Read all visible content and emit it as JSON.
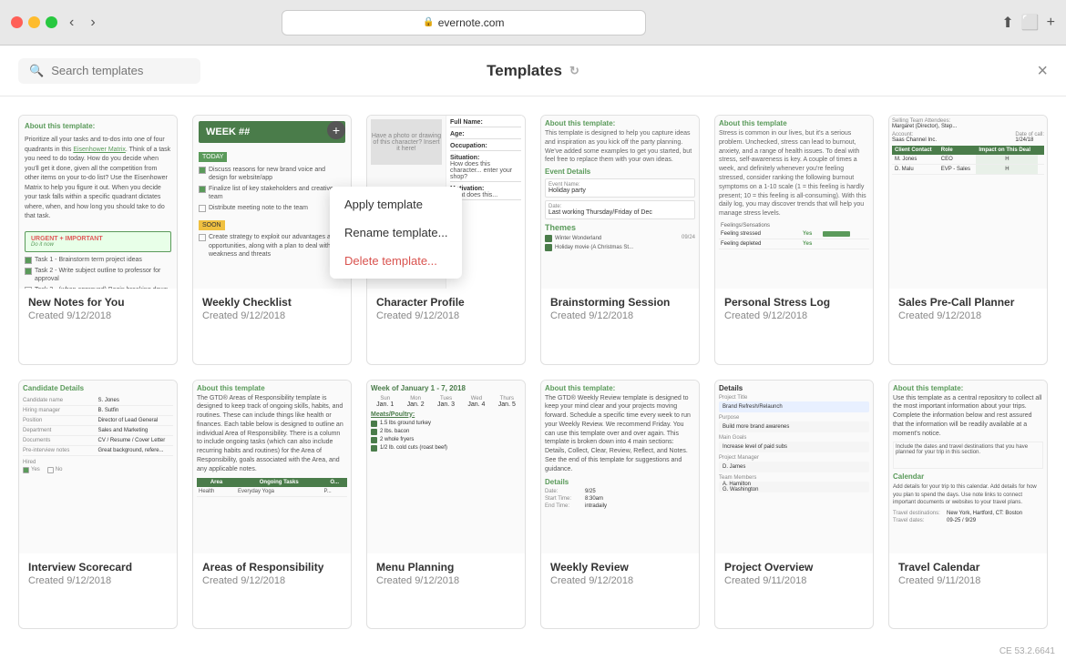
{
  "browser": {
    "url": "evernote.com",
    "traffic_lights": [
      "red",
      "yellow",
      "green"
    ]
  },
  "header": {
    "search_placeholder": "Search templates",
    "title": "Templates",
    "close_label": "×"
  },
  "context_menu": {
    "items": [
      {
        "id": "apply",
        "label": "Apply template"
      },
      {
        "id": "rename",
        "label": "Rename template..."
      },
      {
        "id": "delete",
        "label": "Delete template..."
      }
    ]
  },
  "templates_row1": [
    {
      "id": "new-notes",
      "name": "New Notes for You",
      "created": "Created 9/12/2018"
    },
    {
      "id": "weekly-checklist",
      "name": "Weekly Checklist",
      "created": "Created 9/12/2018"
    },
    {
      "id": "character-profile",
      "name": "Character Profile",
      "created": "Created 9/12/2018"
    },
    {
      "id": "brainstorming-session",
      "name": "Brainstorming Session",
      "created": "Created 9/12/2018"
    },
    {
      "id": "personal-stress-log",
      "name": "Personal Stress Log",
      "created": "Created 9/12/2018"
    },
    {
      "id": "sales-pre-call",
      "name": "Sales Pre-Call Planner",
      "created": "Created 9/12/2018"
    }
  ],
  "templates_row2": [
    {
      "id": "interview-scorecard",
      "name": "Interview Scorecard",
      "created": "Created 9/12/2018"
    },
    {
      "id": "areas-of-responsibility",
      "name": "Areas of Responsibility",
      "created": "Created 9/12/2018"
    },
    {
      "id": "menu-planning",
      "name": "Menu Planning",
      "created": "Created 9/12/2018"
    },
    {
      "id": "weekly-review",
      "name": "Weekly Review",
      "created": "Created 9/12/2018"
    },
    {
      "id": "project-overview",
      "name": "Project Overview",
      "created": "Created 9/11/2018"
    },
    {
      "id": "travel-calendar",
      "name": "Travel Calendar",
      "created": "Created 9/11/2018"
    }
  ],
  "footer": {
    "version": "CE 53.2.6641"
  }
}
